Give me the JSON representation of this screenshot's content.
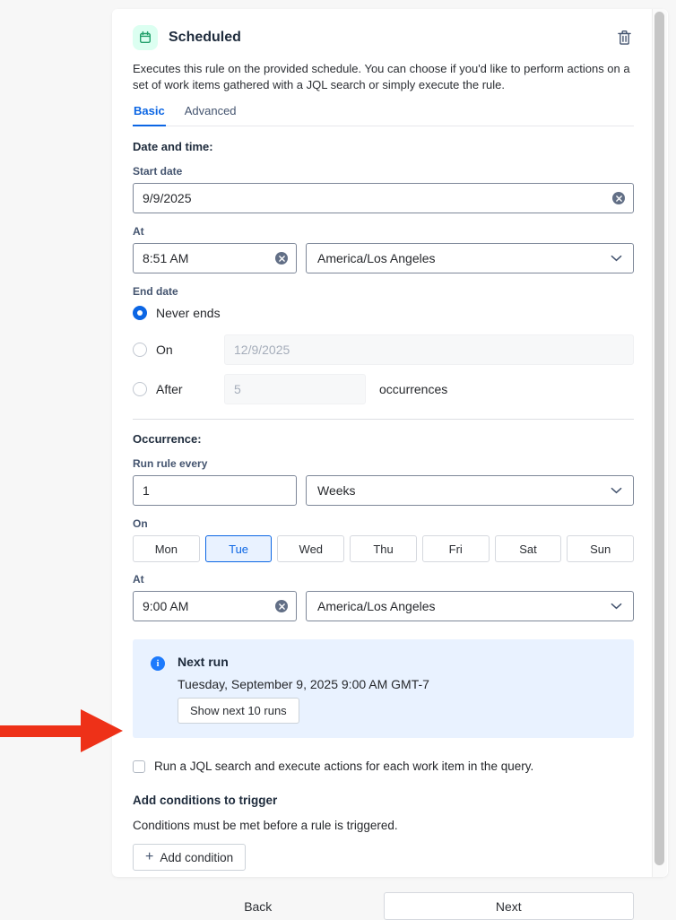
{
  "colors": {
    "accent_blue": "#0c66e4",
    "info_panel_bg": "#e9f2ff",
    "trigger_green": "#22a06b",
    "trigger_green_bg": "#dcfff1",
    "annotation_red": "#ee3118"
  },
  "header": {
    "title": "Scheduled",
    "description": "Executes this rule on the provided schedule. You can choose if you'd like to perform actions on a set of work items gathered with a JQL search or simply execute the rule."
  },
  "tabs": [
    {
      "label": "Basic",
      "active": true
    },
    {
      "label": "Advanced",
      "active": false
    }
  ],
  "date_time": {
    "section_label": "Date and time:",
    "start_date": {
      "label": "Start date",
      "value": "9/9/2025"
    },
    "at": {
      "label": "At",
      "time": "8:51 AM",
      "timezone": "America/Los Angeles"
    },
    "end_date": {
      "label": "End date",
      "never_ends": {
        "label": "Never ends",
        "selected": true
      },
      "on": {
        "label": "On",
        "selected": false,
        "placeholder": "12/9/2025"
      },
      "after": {
        "label": "After",
        "selected": false,
        "placeholder": "5",
        "suffix": "occurrences"
      }
    }
  },
  "occurrence": {
    "section_label": "Occurrence:",
    "run_rule_every": {
      "label": "Run rule every",
      "value": "1",
      "unit": "Weeks"
    },
    "on_days": {
      "label": "On",
      "days": [
        "Mon",
        "Tue",
        "Wed",
        "Thu",
        "Fri",
        "Sat",
        "Sun"
      ],
      "selected_day": "Tue"
    },
    "at": {
      "label": "At",
      "time": "9:00 AM",
      "timezone": "America/Los Angeles"
    }
  },
  "next_run": {
    "title": "Next run",
    "datetime": "Tuesday, September 9, 2025 9:00 AM GMT-7",
    "button_label": "Show next 10 runs"
  },
  "jql_checkbox": {
    "checked": false,
    "label": "Run a JQL search and execute actions for each work item in the query."
  },
  "conditions": {
    "title": "Add conditions to trigger",
    "description": "Conditions must be met before a rule is triggered.",
    "add_button_label": "Add condition"
  },
  "footer": {
    "back_label": "Back",
    "next_label": "Next"
  }
}
